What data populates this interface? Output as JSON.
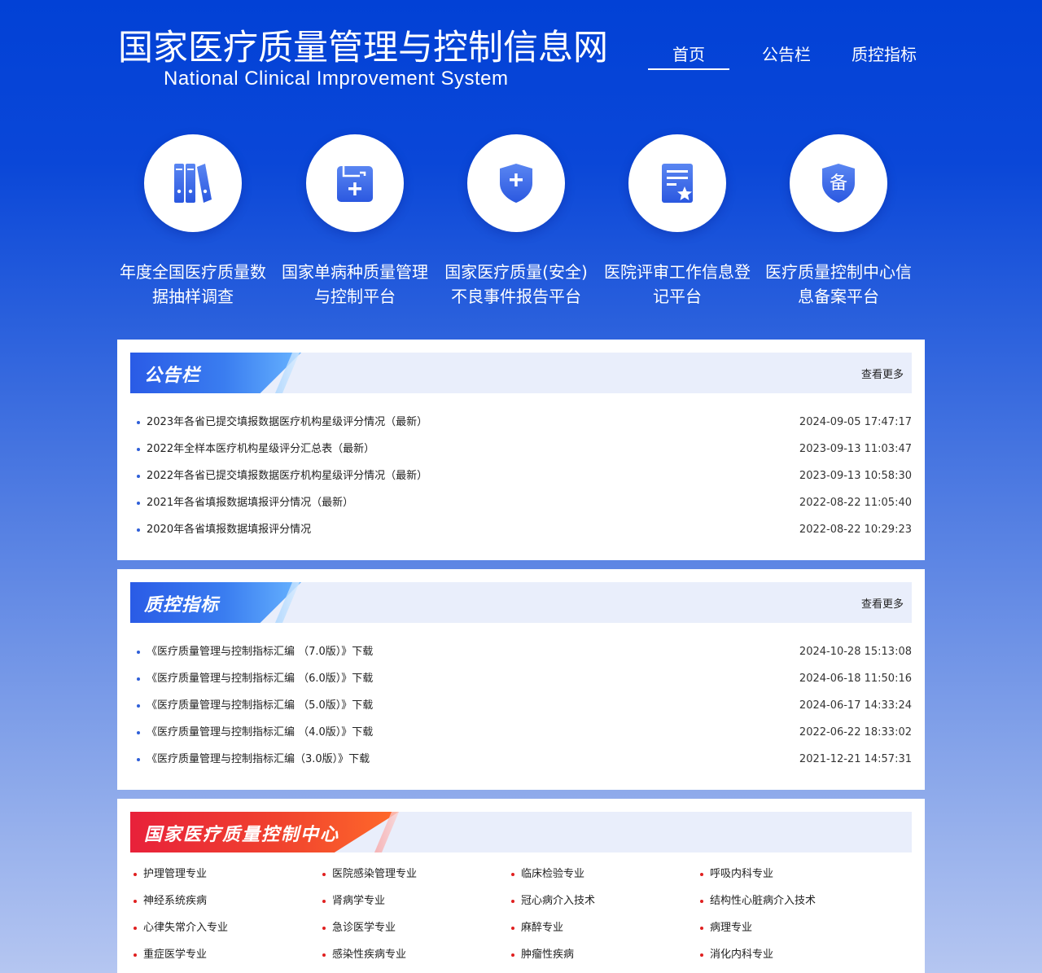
{
  "header": {
    "title_cn": "国家医疗质量管理与控制信息网",
    "title_en": "National Clinical Improvement System"
  },
  "nav": {
    "items": [
      {
        "label": "首页",
        "active": true
      },
      {
        "label": "公告栏",
        "active": false
      },
      {
        "label": "质控指标",
        "active": false
      }
    ]
  },
  "portals": [
    {
      "label": "年度全国医疗质量数据抽样调查",
      "icon": "books-icon"
    },
    {
      "label": "国家单病种质量管理与控制平台",
      "icon": "medical-folder-icon"
    },
    {
      "label": "国家医疗质量(安全)不良事件报告平台",
      "icon": "shield-plus-icon"
    },
    {
      "label": "医院评审工作信息登记平台",
      "icon": "certificate-star-icon"
    },
    {
      "label": "医疗质量控制中心信息备案平台",
      "icon": "record-shield-icon",
      "glyph": "备"
    }
  ],
  "notice": {
    "title": "公告栏",
    "more": "查看更多",
    "items": [
      {
        "text": "2023年各省已提交填报数据医疗机构星级评分情况（最新）",
        "date": "2024-09-05 17:47:17"
      },
      {
        "text": "2022年全样本医疗机构星级评分汇总表（最新）",
        "date": "2023-09-13 11:03:47"
      },
      {
        "text": "2022年各省已提交填报数据医疗机构星级评分情况（最新）",
        "date": "2023-09-13 10:58:30"
      },
      {
        "text": "2021年各省填报数据填报评分情况（最新）",
        "date": "2022-08-22 11:05:40"
      },
      {
        "text": "2020年各省填报数据填报评分情况",
        "date": "2022-08-22 10:29:23"
      }
    ]
  },
  "indicators": {
    "title": "质控指标",
    "more": "查看更多",
    "items": [
      {
        "text": "《医疗质量管理与控制指标汇编 （7.0版）》下载",
        "date": "2024-10-28 15:13:08"
      },
      {
        "text": "《医疗质量管理与控制指标汇编 （6.0版）》下载",
        "date": "2024-06-18 11:50:16"
      },
      {
        "text": "《医疗质量管理与控制指标汇编 （5.0版）》下载",
        "date": "2024-06-17 14:33:24"
      },
      {
        "text": "《医疗质量管理与控制指标汇编 （4.0版）》下载",
        "date": "2022-06-22 18:33:02"
      },
      {
        "text": "《医疗质量管理与控制指标汇编（3.0版）》下载",
        "date": "2021-12-21 14:57:31"
      }
    ]
  },
  "center": {
    "title": "国家医疗质量控制中心",
    "items": [
      "护理管理专业",
      "医院感染管理专业",
      "临床检验专业",
      "呼吸内科专业",
      "神经系统疾病",
      "肾病学专业",
      "冠心病介入技术",
      "结构性心脏病介入技术",
      "心律失常介入专业",
      "急诊医学专业",
      "麻醉专业",
      "病理专业",
      "重症医学专业",
      "感染性疾病专业",
      "肿瘤性疾病",
      "消化内科专业"
    ]
  },
  "colors": {
    "bg_top": "#0241d6",
    "bg_bottom": "#b5c6f1",
    "panel_head_bg": "#e9eefb",
    "blue_tab": "#2a5be6",
    "red_tab": "#e8213a",
    "icon_blue": "#2f5fe8"
  }
}
